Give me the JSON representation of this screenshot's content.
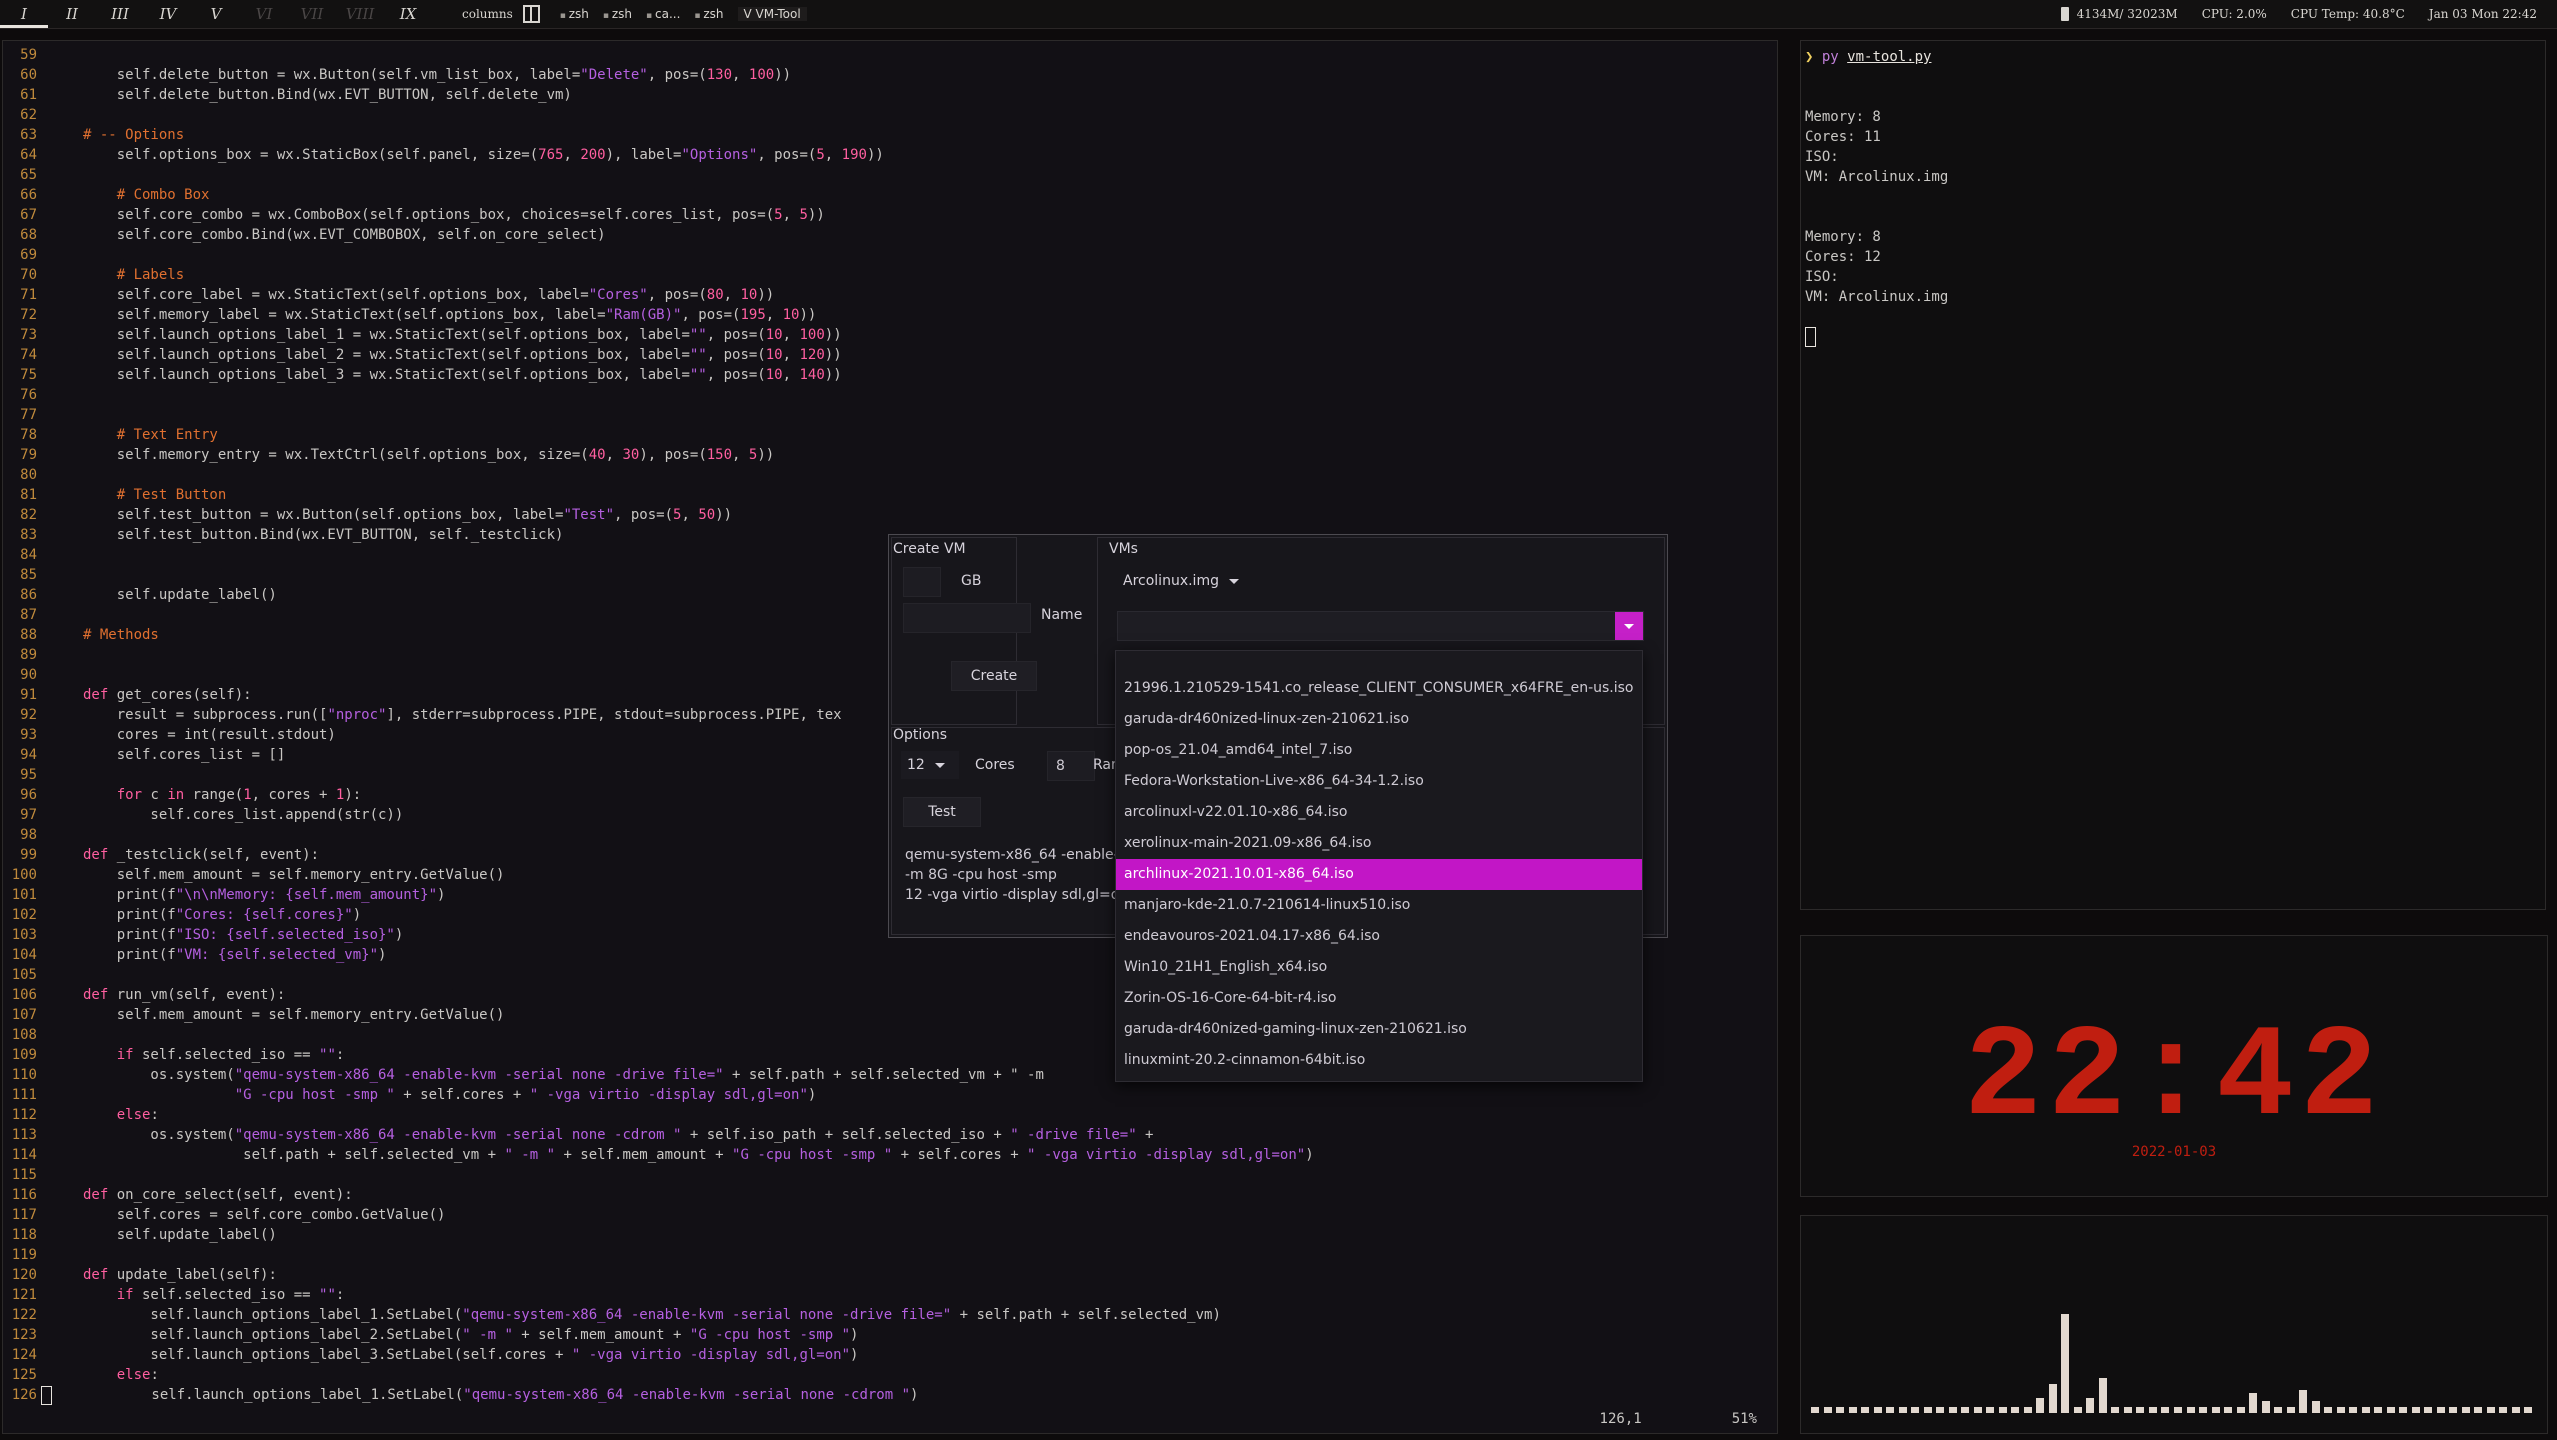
{
  "topbar": {
    "workspaces": [
      "I",
      "II",
      "III",
      "IV",
      "V",
      "VI",
      "VII",
      "VIII",
      "IX"
    ],
    "active_workspace": "I",
    "dim_workspaces": [
      "VI",
      "VII",
      "VIII"
    ],
    "layout": "columns",
    "tabs": [
      "zsh",
      "zsh",
      "ca...",
      "zsh",
      "V VM-Tool"
    ],
    "memory": "4134M/ 32023M",
    "cpu": "CPU: 2.0%",
    "cpu_temp": "CPU Temp: 40.8°C",
    "datetime": "Jan 03 Mon 22:42"
  },
  "editor": {
    "lines": [
      {
        "n": "59",
        "code": ""
      },
      {
        "n": "60",
        "code": "    self.delete_button = wx.Button(self.vm_list_box, label=\"Delete\", pos=(130, 100))"
      },
      {
        "n": "61",
        "code": "    self.delete_button.Bind(wx.EVT_BUTTON, self.delete_vm)"
      },
      {
        "n": "62",
        "code": ""
      },
      {
        "n": "63",
        "code": "# -- Options"
      },
      {
        "n": "64",
        "code": "    self.options_box = wx.StaticBox(self.panel, size=(765, 200), label=\"Options\", pos=(5, 190))"
      },
      {
        "n": "65",
        "code": ""
      },
      {
        "n": "66",
        "code": "    # Combo Box"
      },
      {
        "n": "67",
        "code": "    self.core_combo = wx.ComboBox(self.options_box, choices=self.cores_list, pos=(5, 5))"
      },
      {
        "n": "68",
        "code": "    self.core_combo.Bind(wx.EVT_COMBOBOX, self.on_core_select)"
      },
      {
        "n": "69",
        "code": ""
      },
      {
        "n": "70",
        "code": "    # Labels"
      },
      {
        "n": "71",
        "code": "    self.core_label = wx.StaticText(self.options_box, label=\"Cores\", pos=(80, 10))"
      },
      {
        "n": "72",
        "code": "    self.memory_label = wx.StaticText(self.options_box, label=\"Ram(GB)\", pos=(195, 10))"
      },
      {
        "n": "73",
        "code": "    self.launch_options_label_1 = wx.StaticText(self.options_box, label=\"\", pos=(10, 100))"
      },
      {
        "n": "74",
        "code": "    self.launch_options_label_2 = wx.StaticText(self.options_box, label=\"\", pos=(10, 120))"
      },
      {
        "n": "75",
        "code": "    self.launch_options_label_3 = wx.StaticText(self.options_box, label=\"\", pos=(10, 140))"
      },
      {
        "n": "76",
        "code": ""
      },
      {
        "n": "77",
        "code": ""
      },
      {
        "n": "78",
        "code": "    # Text Entry"
      },
      {
        "n": "79",
        "code": "    self.memory_entry = wx.TextCtrl(self.options_box, size=(40, 30), pos=(150, 5))"
      },
      {
        "n": "80",
        "code": ""
      },
      {
        "n": "81",
        "code": "    # Test Button"
      },
      {
        "n": "82",
        "code": "    self.test_button = wx.Button(self.options_box, label=\"Test\", pos=(5, 50))"
      },
      {
        "n": "83",
        "code": "    self.test_button.Bind(wx.EVT_BUTTON, self._testclick)"
      },
      {
        "n": "84",
        "code": ""
      },
      {
        "n": "85",
        "code": ""
      },
      {
        "n": "86",
        "code": "    self.update_label()"
      },
      {
        "n": "87",
        "code": ""
      },
      {
        "n": "88",
        "code": "# Methods"
      },
      {
        "n": "89",
        "code": ""
      },
      {
        "n": "90",
        "code": ""
      },
      {
        "n": "91",
        "code": "def get_cores(self):"
      },
      {
        "n": "92",
        "code": "    result = subprocess.run([\"nproc\"], stderr=subprocess.PIPE, stdout=subprocess.PIPE, tex"
      },
      {
        "n": "93",
        "code": "    cores = int(result.stdout)"
      },
      {
        "n": "94",
        "code": "    self.cores_list = []"
      },
      {
        "n": "95",
        "code": ""
      },
      {
        "n": "96",
        "code": "    for c in range(1, cores + 1):"
      },
      {
        "n": "97",
        "code": "        self.cores_list.append(str(c))"
      },
      {
        "n": "98",
        "code": ""
      },
      {
        "n": "99",
        "code": "def _testclick(self, event):"
      },
      {
        "n": "100",
        "code": "    self.mem_amount = self.memory_entry.GetValue()"
      },
      {
        "n": "101",
        "code": "    print(f\"\\n\\nMemory: {self.mem_amount}\")"
      },
      {
        "n": "102",
        "code": "    print(f\"Cores: {self.cores}\")"
      },
      {
        "n": "103",
        "code": "    print(f\"ISO: {self.selected_iso}\")"
      },
      {
        "n": "104",
        "code": "    print(f\"VM: {self.selected_vm}\")"
      },
      {
        "n": "105",
        "code": ""
      },
      {
        "n": "106",
        "code": "def run_vm(self, event):"
      },
      {
        "n": "107",
        "code": "    self.mem_amount = self.memory_entry.GetValue()"
      },
      {
        "n": "108",
        "code": ""
      },
      {
        "n": "109",
        "code": "    if self.selected_iso == \"\":"
      },
      {
        "n": "110",
        "code": "        os.system(\"qemu-system-x86_64 -enable-kvm -serial none -drive file=\" + self.path + self.selected_vm + \" -m"
      },
      {
        "n": "111",
        "code": "                  \"G -cpu host -smp \" + self.cores + \" -vga virtio -display sdl,gl=on\")"
      },
      {
        "n": "112",
        "code": "    else:"
      },
      {
        "n": "113",
        "code": "        os.system(\"qemu-system-x86_64 -enable-kvm -serial none -cdrom \" + self.iso_path + self.selected_iso + \" -drive file=\" +"
      },
      {
        "n": "114",
        "code": "                   self.path + self.selected_vm + \" -m \" + self.mem_amount + \"G -cpu host -smp \" + self.cores + \" -vga virtio -display sdl,gl=on\")"
      },
      {
        "n": "115",
        "code": ""
      },
      {
        "n": "116",
        "code": "def on_core_select(self, event):"
      },
      {
        "n": "117",
        "code": "    self.cores = self.core_combo.GetValue()"
      },
      {
        "n": "118",
        "code": "    self.update_label()"
      },
      {
        "n": "119",
        "code": ""
      },
      {
        "n": "120",
        "code": "def update_label(self):"
      },
      {
        "n": "121",
        "code": "    if self.selected_iso == \"\":"
      },
      {
        "n": "122",
        "code": "        self.launch_options_label_1.SetLabel(\"qemu-system-x86_64 -enable-kvm -serial none -drive file=\" + self.path + self.selected_vm)"
      },
      {
        "n": "123",
        "code": "        self.launch_options_label_2.SetLabel(\" -m \" + self.mem_amount + \"G -cpu host -smp \")"
      },
      {
        "n": "124",
        "code": "        self.launch_options_label_3.SetLabel(self.cores + \" -vga virtio -display sdl,gl=on\")"
      },
      {
        "n": "125",
        "code": "    else:"
      },
      {
        "n": "126",
        "code": "        self.launch_options_label_1.SetLabel(\"qemu-system-x86_64 -enable-kvm -serial none -cdrom \")"
      }
    ],
    "cursor_pos": "126,1",
    "scroll_percent": "51%"
  },
  "terminal": {
    "prompt_symbol": "❯",
    "command": "py",
    "script": "vm-tool.py",
    "output": [
      "",
      "",
      "Memory: 8",
      "Cores: 11",
      "ISO:",
      "VM: Arcolinux.img",
      "",
      "",
      "Memory: 8",
      "Cores: 12",
      "ISO:",
      "VM: Arcolinux.img"
    ]
  },
  "clock": {
    "time": "22:42",
    "date": "2022-01-03",
    "color": "#c01e10"
  },
  "visualizer": {
    "levels": [
      0.02,
      0.02,
      0.02,
      0.02,
      0.02,
      0.02,
      0.02,
      0.02,
      0.02,
      0.02,
      0.02,
      0.02,
      0.02,
      0.02,
      0.02,
      0.02,
      0.02,
      0.02,
      0.05,
      0.1,
      0.34,
      0.02,
      0.05,
      0.12,
      0.02,
      0.02,
      0.02,
      0.02,
      0.02,
      0.02,
      0.02,
      0.02,
      0.02,
      0.02,
      0.02,
      0.07,
      0.04,
      0.02,
      0.02,
      0.08,
      0.04,
      0.02,
      0.02,
      0.02,
      0.02,
      0.02,
      0.02,
      0.02,
      0.02,
      0.02,
      0.02,
      0.02,
      0.02,
      0.02,
      0.02,
      0.02,
      0.02,
      0.02
    ],
    "bar_color": "#e2d8cf"
  },
  "dialog": {
    "create_group": "Create VM",
    "gb_label": "GB",
    "name_label": "Name",
    "create_button": "Create",
    "vms_group": "VMs",
    "vm_selected": "Arcolinux.img",
    "options_group": "Options",
    "cores_value": "12",
    "cores_label": "Cores",
    "ram_value": "8",
    "ram_label": "Ram",
    "test_button": "Test",
    "cmd_lines": [
      "qemu-system-x86_64 -enable-k",
      "-m 8G -cpu host -smp",
      "12 -vga virtio -display sdl,gl=on"
    ],
    "accent": "#c216c6"
  },
  "iso_dropdown": {
    "items": [
      "21996.1.210529-1541.co_release_CLIENT_CONSUMER_x64FRE_en-us.iso",
      "garuda-dr460nized-linux-zen-210621.iso",
      "pop-os_21.04_amd64_intel_7.iso",
      "Fedora-Workstation-Live-x86_64-34-1.2.iso",
      "arcolinuxl-v22.01.10-x86_64.iso",
      "xerolinux-main-2021.09-x86_64.iso",
      "archlinux-2021.10.01-x86_64.iso",
      "manjaro-kde-21.0.7-210614-linux510.iso",
      "endeavouros-2021.04.17-x86_64.iso",
      "Win10_21H1_English_x64.iso",
      "Zorin-OS-16-Core-64-bit-r4.iso",
      "garuda-dr460nized-gaming-linux-zen-210621.iso",
      "linuxmint-20.2-cinnamon-64bit.iso"
    ],
    "selected": "archlinux-2021.10.01-x86_64.iso"
  }
}
